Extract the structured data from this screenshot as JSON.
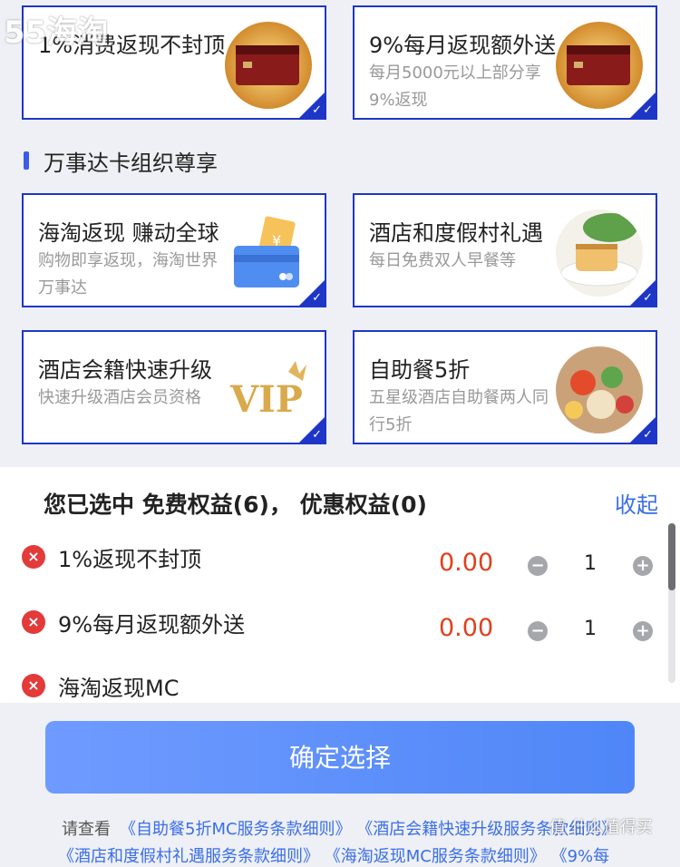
{
  "watermark": {
    "top_left": "55海淘",
    "bottom_right": "值 什么值得买"
  },
  "cards_top": [
    {
      "title": "1%消费返现不封顶",
      "desc": "",
      "image_icon": "credit-card-icon"
    },
    {
      "title": "9%每月返现额外送",
      "desc": "每月5000元以上部分享9%返现",
      "image_icon": "credit-card-icon"
    }
  ],
  "section": {
    "title": "万事达卡组织尊享"
  },
  "cards_bottom": [
    {
      "title": "海淘返现 赚动全球",
      "desc": "购物即享返现，海淘世界万事达",
      "image_icon": "shopping-card-icon"
    },
    {
      "title": "酒店和度假村礼遇",
      "desc": "每日免费双人早餐等",
      "image_icon": "breakfast-icon"
    },
    {
      "title": "酒店会籍快速升级",
      "desc": "快速升级酒店会员资格",
      "image_icon": "vip-icon"
    },
    {
      "title": "自助餐5折",
      "desc": "五星级酒店自助餐两人同行5折",
      "image_icon": "buffet-icon"
    }
  ],
  "selection": {
    "summary": "您已选中 免费权益(6)，  优惠权益(0)",
    "collapse_label": "收起",
    "items": [
      {
        "name": "1%返现不封顶",
        "price": "0.00",
        "qty": "1"
      },
      {
        "name": "9%每月返现额外送",
        "price": "0.00",
        "qty": "1"
      },
      {
        "name": "海淘返现MC",
        "price": "",
        "qty": ""
      }
    ]
  },
  "confirm_label": "确定选择",
  "terms": {
    "lead": "请查看",
    "line1": [
      "《自助餐5折MC服务条款细则》",
      "《酒店会籍快速升级服务条款细则》"
    ],
    "line2": [
      "《酒店和度假村礼遇服务条款细则》",
      "《海淘返现MC服务条款细则》",
      "《9%每"
    ]
  },
  "colors": {
    "accent": "#1e36c8",
    "price": "#e0401c",
    "link": "#3a6ee8",
    "remove": "#e33a3a"
  }
}
